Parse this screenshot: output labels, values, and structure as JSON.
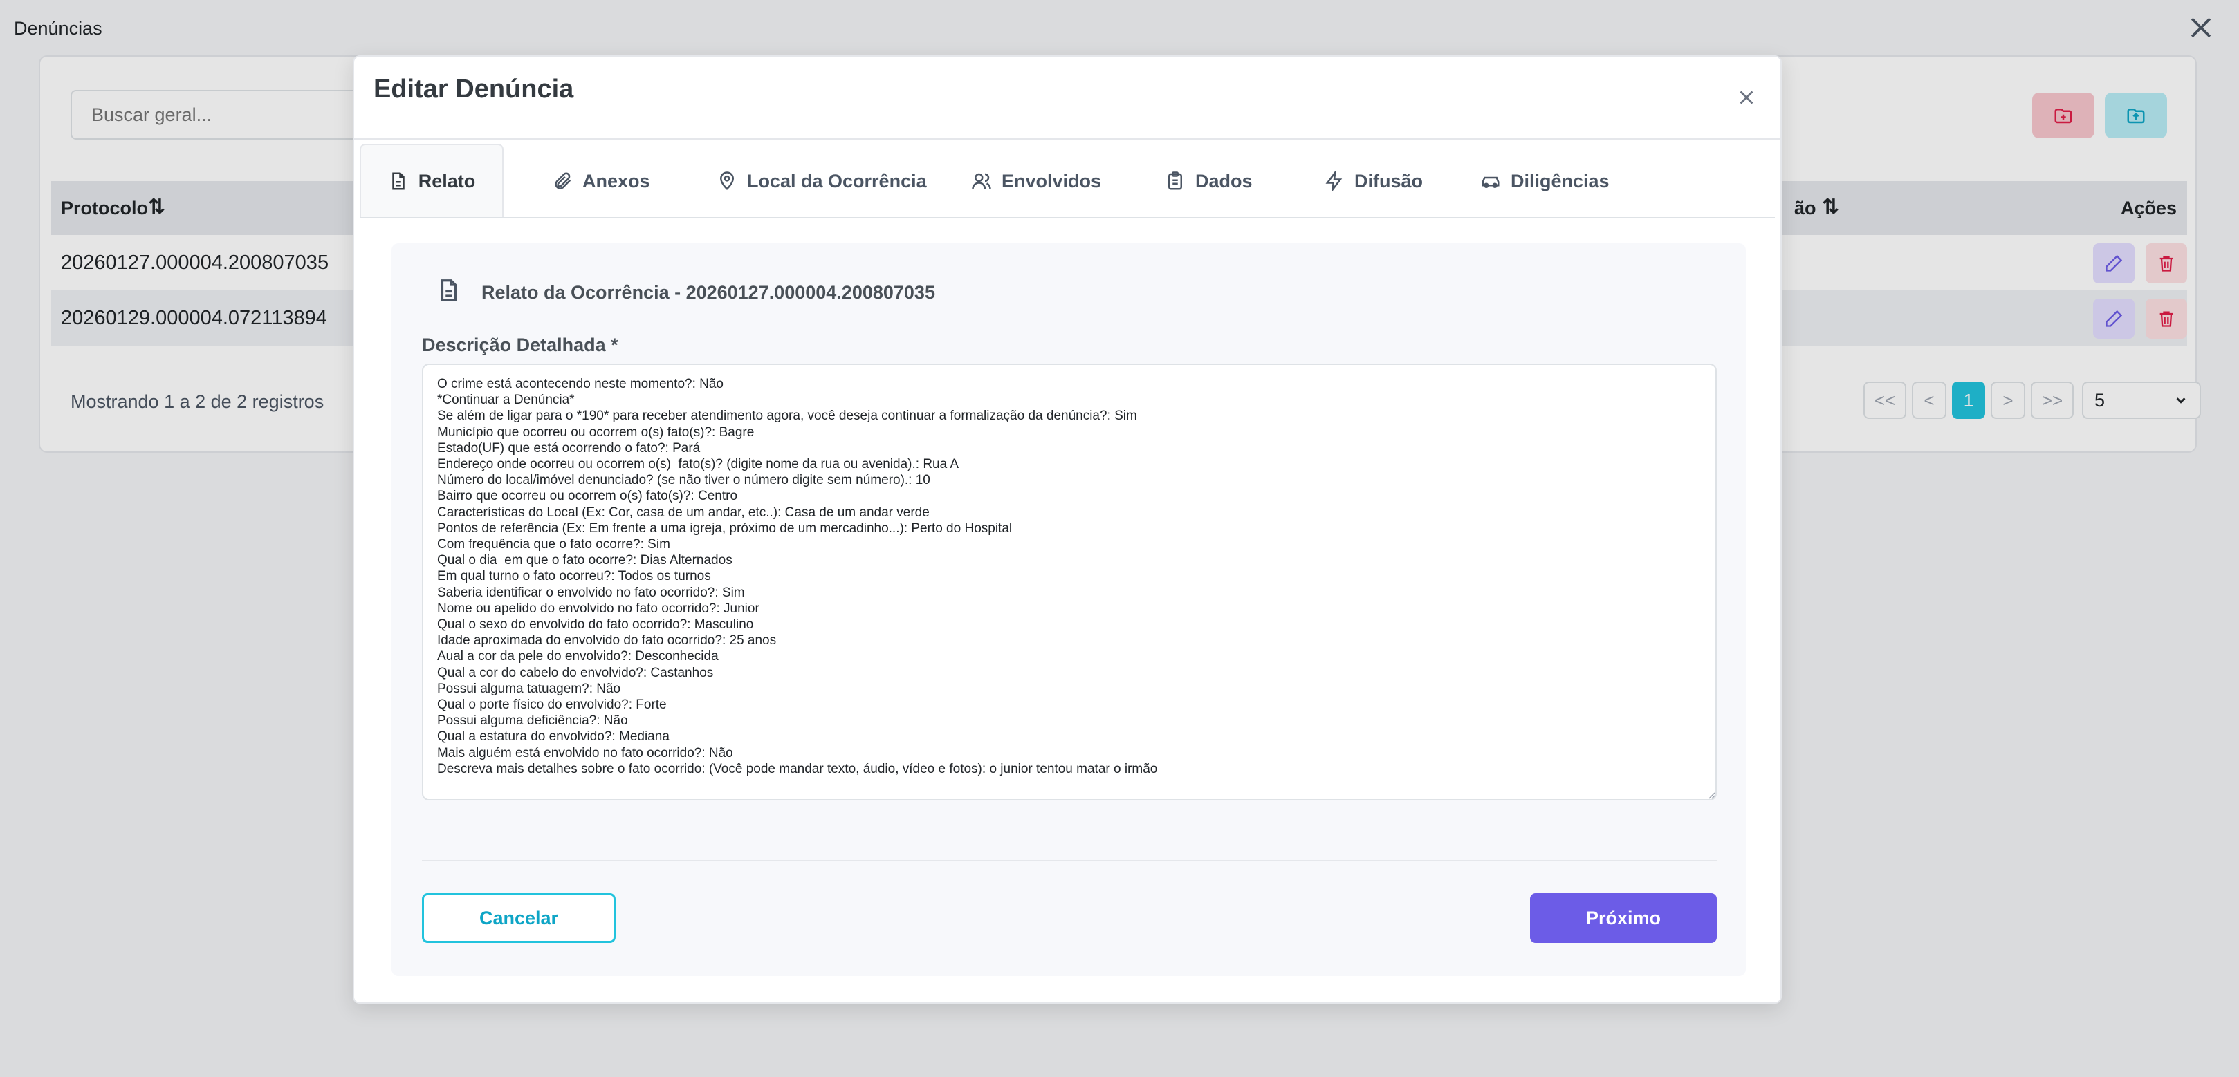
{
  "page": {
    "title": "Denúncias",
    "search_placeholder": "Buscar geral...",
    "table": {
      "columns": [
        "Protocolo",
        "ão",
        "Ações"
      ],
      "rows": [
        {
          "protocolo": "20260127.000004.200807035"
        },
        {
          "protocolo": "20260129.000004.072113894"
        }
      ]
    },
    "showing": "Mostrando 1 a 2 de 2 registros",
    "pagination": {
      "first": "<<",
      "prev": "<",
      "current": "1",
      "next": ">",
      "last": ">>",
      "page_size": "5"
    }
  },
  "modal": {
    "title": "Editar Denúncia",
    "tabs": [
      {
        "label": "Relato",
        "icon": "file-text-icon",
        "active": true
      },
      {
        "label": "Anexos",
        "icon": "paperclip-icon"
      },
      {
        "label": "Local da Ocorrência",
        "icon": "map-pin-icon"
      },
      {
        "label": "Envolvidos",
        "icon": "users-icon"
      },
      {
        "label": "Dados",
        "icon": "clipboard-icon"
      },
      {
        "label": "Difusão",
        "icon": "zap-icon"
      },
      {
        "label": "Diligências",
        "icon": "car-icon"
      }
    ],
    "panel_title": "Relato da Ocorrência - 20260127.000004.200807035",
    "description_label": "Descrição Detalhada *",
    "description": "O crime está acontecendo neste momento?: Não\n*Continuar a Denúncia*\nSe além de ligar para o *190* para receber atendimento agora, você deseja continuar a formalização da denúncia?: Sim\nMunicípio que ocorreu ou ocorrem o(s) fato(s)?: Bagre\nEstado(UF) que está ocorrendo o fato?: Pará\nEndereço onde ocorreu ou ocorrem o(s)  fato(s)? (digite nome da rua ou avenida).: Rua A\nNúmero do local/imóvel denunciado? (se não tiver o número digite sem número).: 10\nBairro que ocorreu ou ocorrem o(s) fato(s)?: Centro\nCaracterísticas do Local (Ex: Cor, casa de um andar, etc..): Casa de um andar verde\nPontos de referência (Ex: Em frente a uma igreja, próximo de um mercadinho...): Perto do Hospital\nCom frequência que o fato ocorre?: Sim\nQual o dia  em que o fato ocorre?: Dias Alternados\nEm qual turno o fato ocorreu?: Todos os turnos\nSaberia identificar o envolvido no fato ocorrido?: Sim\nNome ou apelido do envolvido no fato ocorrido?: Junior\nQual o sexo do envolvido do fato ocorrido?: Masculino\nIdade aproximada do envolvido do fato ocorrido?: 25 anos\nAual a cor da pele do envolvido?: Desconhecida\nQual a cor do cabelo do envolvido?: Castanhos\nPossui alguma tatuagem?: Não\nQual o porte físico do envolvido?: Forte\nPossui alguma deficiência?: Não\nQual a estatura do envolvido?: Mediana\nMais alguém está envolvido no fato ocorrido?: Não\nDescreva mais detalhes sobre o fato ocorrido: (Você pode mandar texto, áudio, vídeo e fotos): o junior tentou matar o irmão",
    "cancel_label": "Cancelar",
    "next_label": "Próximo"
  },
  "colors": {
    "primary": "#6c5ce7",
    "accent": "#22c3dd",
    "danger": "#e11d48"
  }
}
